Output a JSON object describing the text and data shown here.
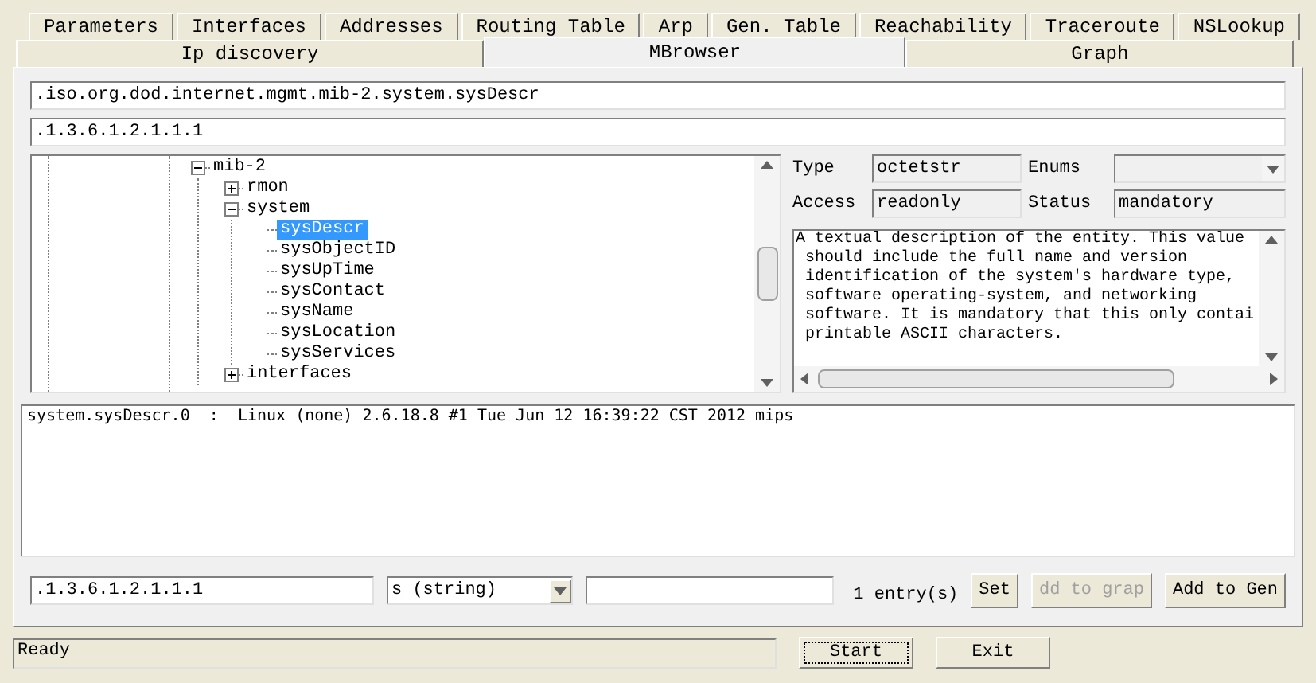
{
  "tabs_row_1": [
    {
      "label": "Parameters",
      "selected": false
    },
    {
      "label": "Interfaces",
      "selected": false
    },
    {
      "label": "Addresses",
      "selected": false
    },
    {
      "label": "Routing Table",
      "selected": false
    },
    {
      "label": "Arp",
      "selected": false
    },
    {
      "label": "Gen. Table",
      "selected": false
    },
    {
      "label": "Reachability",
      "selected": false
    },
    {
      "label": "Traceroute",
      "selected": false
    },
    {
      "label": "NSLookup",
      "selected": false
    }
  ],
  "tabs_row_2": [
    {
      "label": "Ip discovery",
      "selected": false
    },
    {
      "label": "MBrowser",
      "selected": true
    },
    {
      "label": "Graph",
      "selected": false
    }
  ],
  "oid_name_field": {
    "value": ".iso.org.dod.internet.mgmt.mib-2.system.sysDescr"
  },
  "oid_number_field": {
    "value": ".1.3.6.1.2.1.1.1"
  },
  "mib_tree": [
    {
      "label": "mib-2",
      "expanded": true,
      "selected": false,
      "children": [
        {
          "label": "rmon",
          "expanded": false,
          "selected": false
        },
        {
          "label": "system",
          "expanded": true,
          "selected": false,
          "children": [
            {
              "label": "sysDescr",
              "selected": true
            },
            {
              "label": "sysObjectID",
              "selected": false
            },
            {
              "label": "sysUpTime",
              "selected": false
            },
            {
              "label": "sysContact",
              "selected": false
            },
            {
              "label": "sysName",
              "selected": false
            },
            {
              "label": "sysLocation",
              "selected": false
            },
            {
              "label": "sysServices",
              "selected": false
            }
          ]
        },
        {
          "label": "interfaces",
          "expanded": false,
          "selected": false
        }
      ]
    }
  ],
  "details": {
    "type": {
      "label": "Type",
      "value": "octetstr"
    },
    "enums": {
      "label": "Enums"
    },
    "access": {
      "label": "Access",
      "value": "readonly"
    },
    "status": {
      "label": "Status",
      "value": "mandatory"
    },
    "description_lines": [
      "A textual description of the entity. This value",
      " should include the full name and version",
      " identification of the system's hardware type,",
      " software operating-system, and networking",
      " software. It is mandatory that this only contai",
      " printable ASCII characters."
    ]
  },
  "results": [
    "system.sysDescr.0  :  Linux (none) 2.6.18.8 #1 Tue Jun 12 16:39:22 CST 2012 mips"
  ],
  "set_bar": {
    "oid": ".1.3.6.1.2.1.1.1",
    "value_type": "s (string)",
    "entry_count": "1 entry(s)",
    "buttons": [
      {
        "label": "Set",
        "disabled": false
      },
      {
        "label": "dd to grap",
        "disabled": true
      },
      {
        "label": "Add to Gen",
        "disabled": false
      }
    ]
  },
  "status_bar": {
    "text": "Ready"
  },
  "action_buttons": [
    {
      "label": "Start",
      "focused": true
    },
    {
      "label": "Exit",
      "focused": false
    }
  ]
}
